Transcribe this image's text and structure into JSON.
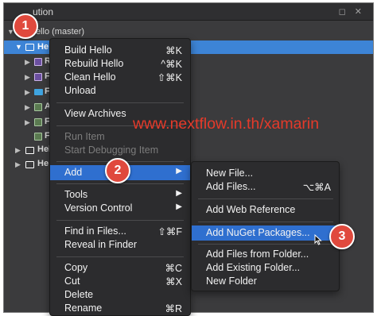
{
  "pad": {
    "title": "ution",
    "buttons": "◻ ✕"
  },
  "tree": [
    {
      "label": "Hello (master)",
      "twisty": "▼"
    },
    {
      "label": "He",
      "twisty": "▼",
      "selected": true
    },
    {
      "label": "R",
      "twisty": "▶"
    },
    {
      "label": "F",
      "twisty": "▶"
    },
    {
      "label": "F",
      "twisty": "▶"
    },
    {
      "label": "A",
      "twisty": "▶"
    },
    {
      "label": "F",
      "twisty": "▶"
    },
    {
      "label": "F",
      "twisty": ""
    },
    {
      "label": "Hel",
      "twisty": "▶"
    },
    {
      "label": "He",
      "twisty": "▶"
    }
  ],
  "context_menu": [
    {
      "label": "Build Hello",
      "shortcut": "⌘K"
    },
    {
      "label": "Rebuild Hello",
      "shortcut": "^⌘K"
    },
    {
      "label": "Clean Hello",
      "shortcut": "⇧⌘K"
    },
    {
      "label": "Unload",
      "shortcut": ""
    },
    {
      "label": "View Archives",
      "shortcut": ""
    },
    {
      "label": "Run Item",
      "shortcut": "",
      "disabled": true
    },
    {
      "label": "Start Debugging Item",
      "shortcut": "",
      "disabled": true
    },
    {
      "label": "Add",
      "shortcut": "▶",
      "highlighted": true
    },
    {
      "label": "Tools",
      "shortcut": "▶"
    },
    {
      "label": "Version Control",
      "shortcut": "▶"
    },
    {
      "label": "Find in Files...",
      "shortcut": "⇧⌘F"
    },
    {
      "label": "Reveal in Finder",
      "shortcut": ""
    },
    {
      "label": "Copy",
      "shortcut": "⌘C"
    },
    {
      "label": "Cut",
      "shortcut": "⌘X"
    },
    {
      "label": "Delete",
      "shortcut": ""
    },
    {
      "label": "Rename",
      "shortcut": "⌘R"
    }
  ],
  "add_submenu": [
    {
      "label": "New File...",
      "shortcut": ""
    },
    {
      "label": "Add Files...",
      "shortcut": "⌥⌘A"
    },
    {
      "label": "Add Web Reference",
      "shortcut": ""
    },
    {
      "label": "Add NuGet Packages...",
      "shortcut": "",
      "highlighted": true
    },
    {
      "label": "Add Files from Folder...",
      "shortcut": ""
    },
    {
      "label": "Add Existing Folder...",
      "shortcut": ""
    },
    {
      "label": "New Folder",
      "shortcut": ""
    }
  ],
  "badges": [
    "1",
    "2",
    "3"
  ],
  "watermark": "www.nextflow.in.th/xamarin",
  "colors": {
    "highlight": "#2f6fcf",
    "selection": "#3d84d6",
    "badge": "#e0493d",
    "watermark": "#e53a2a"
  }
}
